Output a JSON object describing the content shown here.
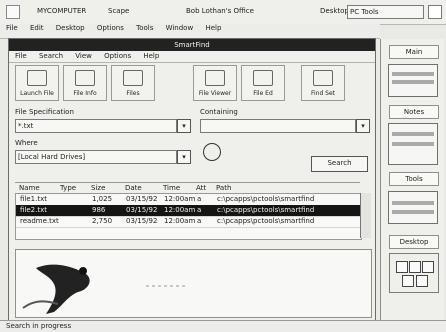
{
  "top": {
    "left_label": "MYCOMPUTER",
    "center_label": "Scape",
    "workspace_label": "Bob Lothan's Office",
    "desktop_label": "Desktop",
    "desktop_value": "PC Tools"
  },
  "menubar": [
    "File",
    "Edit",
    "Desktop",
    "Options",
    "Tools",
    "Window",
    "Help"
  ],
  "window": {
    "title": "SmartFind",
    "menu": [
      "File",
      "Search",
      "View",
      "Options",
      "Help"
    ],
    "toolbar": [
      "Launch File",
      "File Info",
      "Files",
      "File Viewer",
      "File Ed",
      "Find Set"
    ],
    "file_spec_label": "File Specification",
    "file_spec_value": "*.txt",
    "containing_label": "Containing",
    "containing_value": "",
    "where_label": "Where",
    "where_value": "[Local Hard Drives]",
    "search_button": "Search",
    "columns": [
      "Name",
      "Type",
      "Size",
      "Date",
      "Time",
      "Att",
      "Path"
    ],
    "rows": [
      {
        "name": "file1.txt",
        "type": "",
        "size": "1,025",
        "date": "03/15/92",
        "time": "12:00am",
        "att": "a",
        "path": "c:\\pcapps\\pctools\\smartfind"
      },
      {
        "name": "file2.txt",
        "type": "",
        "size": "986",
        "date": "03/15/92",
        "time": "12:00am",
        "att": "a",
        "path": "c:\\pcapps\\pctools\\smartfind"
      },
      {
        "name": "readme.txt",
        "type": "",
        "size": "2,750",
        "date": "03/15/92",
        "time": "12:00am",
        "att": "a",
        "path": "c:\\pcapps\\pctools\\smartfind"
      }
    ]
  },
  "side": {
    "labels": [
      "Main",
      "Notes",
      "Tools",
      "Desktop"
    ]
  },
  "status_text": "Search in progress"
}
